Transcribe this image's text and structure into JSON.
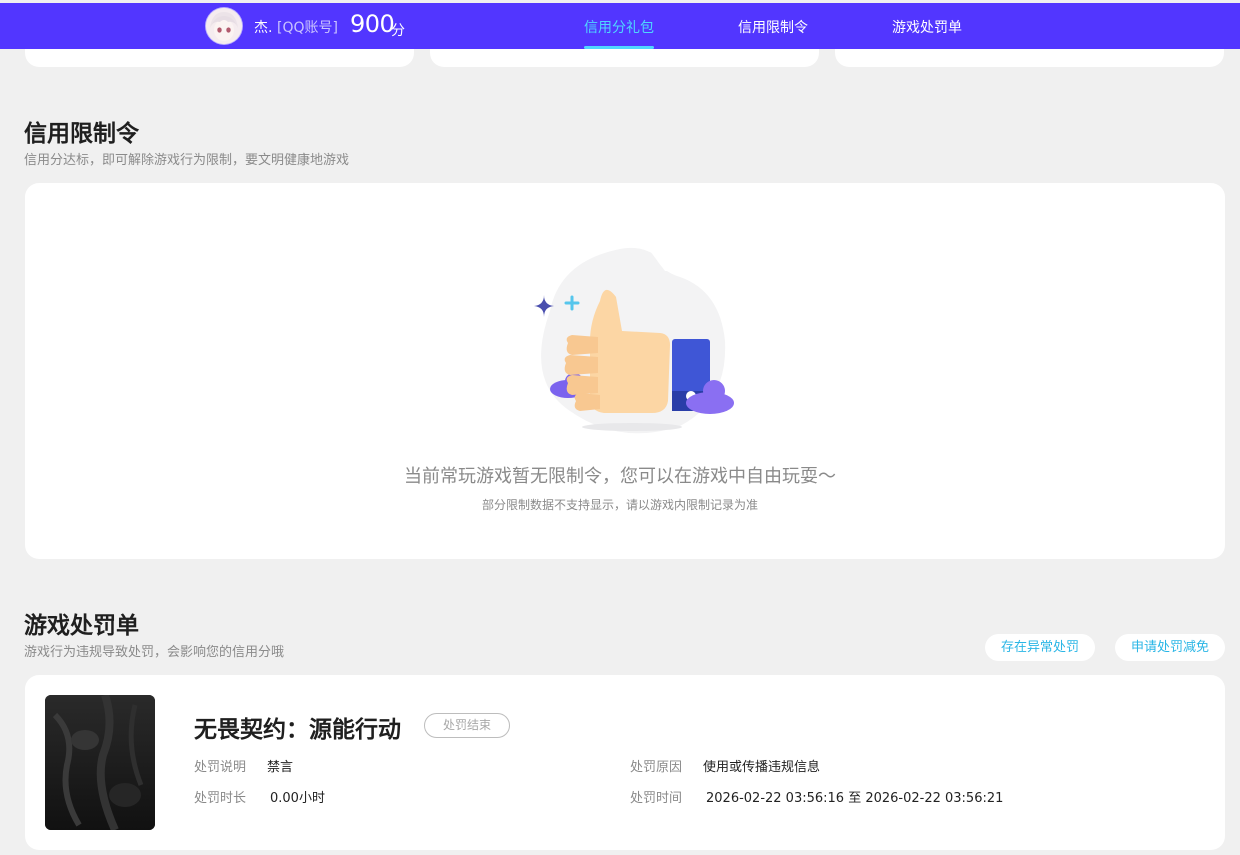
{
  "header": {
    "user_name": "杰.",
    "account_type": "[QQ账号]",
    "score": "900",
    "score_unit": "分",
    "nav": [
      {
        "label": "信用分礼包",
        "active": true
      },
      {
        "label": "信用限制令",
        "active": false
      },
      {
        "label": "游戏处罚单",
        "active": false
      }
    ]
  },
  "restriction": {
    "title": "信用限制令",
    "subtitle": "信用分达标，即可解除游戏行为限制，要文明健康地游戏",
    "empty_message": "当前常玩游戏暂无限制令，您可以在游戏中自由玩耍～",
    "empty_note": "部分限制数据不支持显示，请以游戏内限制记录为准"
  },
  "penalty": {
    "title": "游戏处罚单",
    "subtitle": "游戏行为违规导致处罚，会影响您的信用分哦",
    "buttons": {
      "abnormal": "存在异常处罚",
      "appeal": "申请处罚减免"
    },
    "record": {
      "game_name": "无畏契约：源能行动",
      "status": "处罚结束",
      "desc_label": "处罚说明",
      "desc_value": "禁言",
      "duration_label": "处罚时长",
      "duration_value": "0.00小时",
      "reason_label": "处罚原因",
      "reason_value": "使用或传播违规信息",
      "time_label": "处罚时间",
      "time_value": "2026-02-22 03:56:16 至 2026-02-22 03:56:21"
    }
  },
  "colors": {
    "header_bg": "#5236ff",
    "active_nav": "#4fd7ff",
    "link_blue": "#2ab6e6"
  }
}
